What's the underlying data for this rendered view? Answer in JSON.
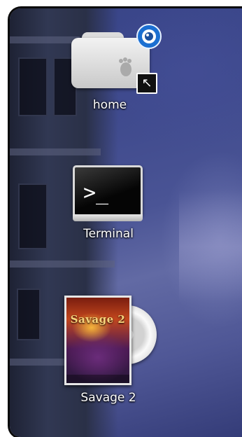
{
  "desktop_icons": [
    {
      "label": "home",
      "icon": "home-folder-icon"
    },
    {
      "label": "Terminal",
      "icon": "terminal-icon",
      "prompt": ">_"
    },
    {
      "label": "Savage 2",
      "icon": "savage2-game-icon",
      "cover_title": "Savage 2"
    }
  ],
  "badges": {
    "home_emblem": "gnome-foot-icon",
    "home_overlay": "user-badge-icon",
    "shortcut": "shortcut-arrow-icon"
  },
  "colors": {
    "label_text": "#ffffff",
    "wallpaper": "#3f4a8d"
  }
}
